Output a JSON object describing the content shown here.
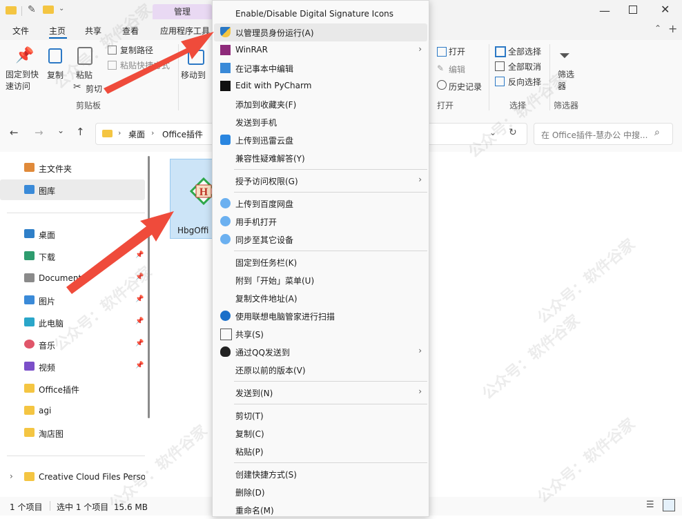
{
  "title_tabs": {
    "manage": "管理"
  },
  "ribbon_tabs": [
    "文件",
    "主页",
    "共享",
    "查看",
    "应用程序工具"
  ],
  "ribbon": {
    "pin_quick": "固定到快\n速访问",
    "copy": "复制",
    "paste": "粘贴",
    "copy_path": "复制路径",
    "paste_shortcut": "粘贴快捷方式",
    "cut": "剪切",
    "clipboard_group": "剪贴板",
    "move_to": "移动到",
    "open": "打开",
    "edit": "编辑",
    "history": "历史记录",
    "open_group": "打开",
    "select_all": "全部选择",
    "select_none": "全部取消",
    "invert": "反向选择",
    "select_group": "选择",
    "filter": "筛选\n器",
    "filter_group": "筛选器"
  },
  "address": {
    "crumbs": [
      "桌面",
      "Office插件"
    ],
    "search_placeholder": "在 Office插件-慧办公 中搜..."
  },
  "nav": {
    "items": [
      {
        "label": "主文件夹",
        "icon": "home-icon",
        "pinned": false
      },
      {
        "label": "图库",
        "icon": "gallery-icon",
        "pinned": false
      },
      {
        "label": "桌面",
        "icon": "desktop-icon",
        "pinned": false
      },
      {
        "label": "下载",
        "icon": "download-icon",
        "pinned": true
      },
      {
        "label": "Documents",
        "icon": "documents-icon",
        "pinned": true
      },
      {
        "label": "图片",
        "icon": "pictures-icon",
        "pinned": true
      },
      {
        "label": "此电脑",
        "icon": "pc-icon",
        "pinned": true
      },
      {
        "label": "音乐",
        "icon": "music-icon",
        "pinned": true
      },
      {
        "label": "视频",
        "icon": "video-icon",
        "pinned": true
      },
      {
        "label": "Office插件",
        "icon": "folder-icon",
        "pinned": false
      },
      {
        "label": "agi",
        "icon": "folder-icon",
        "pinned": false
      },
      {
        "label": "淘店图",
        "icon": "folder-icon",
        "pinned": false
      },
      {
        "label": "Creative Cloud Files Person",
        "icon": "folder-icon",
        "pinned": false
      }
    ]
  },
  "file": {
    "name": "HbgOffi"
  },
  "status": {
    "count": "1 个项目",
    "selected": "选中 1 个项目  15.6 MB"
  },
  "menu": {
    "items": [
      {
        "label": "Enable/Disable Digital Signature Icons",
        "icon": "",
        "arrow": false
      },
      {
        "label": "以管理员身份运行(A)",
        "icon": "shield-icon",
        "arrow": false,
        "highlight": true
      },
      {
        "label": "WinRAR",
        "icon": "winrar-icon",
        "arrow": true
      },
      {
        "label": "在记事本中编辑",
        "icon": "notepad-icon",
        "arrow": false
      },
      {
        "label": "Edit with PyCharm",
        "icon": "pycharm-icon",
        "arrow": false
      },
      {
        "label": "添加到收藏夹(F)",
        "icon": "",
        "arrow": false
      },
      {
        "label": "发送到手机",
        "icon": "",
        "arrow": false
      },
      {
        "label": "上传到迅雷云盘",
        "icon": "thunder-icon",
        "arrow": false
      },
      {
        "label": "兼容性疑难解答(Y)",
        "icon": "",
        "arrow": false
      },
      {
        "label": "授予访问权限(G)",
        "icon": "",
        "arrow": true,
        "sep_before": true
      },
      {
        "label": "上传到百度网盘",
        "icon": "baidu-icon",
        "arrow": false,
        "sep_before": true
      },
      {
        "label": "用手机打开",
        "icon": "baidu-icon",
        "arrow": false
      },
      {
        "label": "同步至其它设备",
        "icon": "baidu-icon",
        "arrow": false
      },
      {
        "label": "固定到任务栏(K)",
        "icon": "",
        "arrow": false,
        "sep_before": true
      },
      {
        "label": "附到「开始」菜单(U)",
        "icon": "",
        "arrow": false
      },
      {
        "label": "复制文件地址(A)",
        "icon": "",
        "arrow": false
      },
      {
        "label": "使用联想电脑管家进行扫描",
        "icon": "lenovo-icon",
        "arrow": false
      },
      {
        "label": "共享(S)",
        "icon": "share-icon",
        "arrow": false
      },
      {
        "label": "通过QQ发送到",
        "icon": "qq-icon",
        "arrow": true
      },
      {
        "label": "还原以前的版本(V)",
        "icon": "",
        "arrow": false
      },
      {
        "label": "发送到(N)",
        "icon": "",
        "arrow": true,
        "sep_before": true
      },
      {
        "label": "剪切(T)",
        "icon": "",
        "arrow": false,
        "sep_before": true
      },
      {
        "label": "复制(C)",
        "icon": "",
        "arrow": false
      },
      {
        "label": "粘贴(P)",
        "icon": "",
        "arrow": false
      },
      {
        "label": "创建快捷方式(S)",
        "icon": "",
        "arrow": false,
        "sep_before": true
      },
      {
        "label": "删除(D)",
        "icon": "",
        "arrow": false
      },
      {
        "label": "重命名(M)",
        "icon": "",
        "arrow": false
      }
    ]
  },
  "watermark": "公众号：软件谷家"
}
